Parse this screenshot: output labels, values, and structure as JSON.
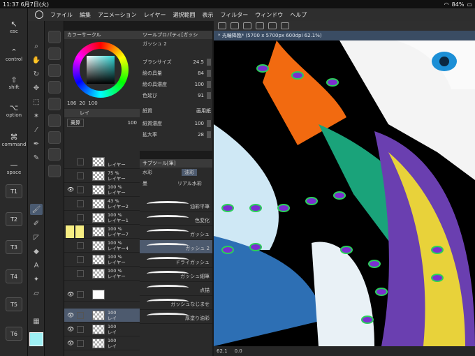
{
  "status": {
    "time": "11:37",
    "date": "6月7日(火)",
    "battery": "84%"
  },
  "menu": [
    "ファイル",
    "編集",
    "アニメーション",
    "レイヤー",
    "選択範囲",
    "表示",
    "フィルター",
    "ウィンドウ",
    "ヘルプ"
  ],
  "shortcuts": [
    {
      "glyph": "↖",
      "label": "esc"
    },
    {
      "glyph": "⌃",
      "label": "control"
    },
    {
      "glyph": "⇧",
      "label": "shift"
    },
    {
      "glyph": "⌥",
      "label": "option"
    },
    {
      "glyph": "⌘",
      "label": "command"
    },
    {
      "glyph": "—",
      "label": "space"
    }
  ],
  "tkeys": [
    "T1",
    "T2",
    "T3",
    "T4",
    "T5",
    "T6"
  ],
  "color_panel": {
    "title": "カラーサークル",
    "values": [
      "186",
      "20",
      "100"
    ]
  },
  "layer_panel": {
    "tab": "レイ",
    "blend": "乗算",
    "opacity": "100",
    "rows": [
      {
        "pct": "",
        "name": "レイヤー"
      },
      {
        "pct": "75 %",
        "name": "レイヤー"
      },
      {
        "pct": "100 %",
        "name": "レイヤー"
      },
      {
        "pct": "43 %",
        "name": "レイヤー2"
      },
      {
        "pct": "100 %",
        "name": "レイヤー1"
      },
      {
        "pct": "100 %",
        "name": "レイヤー7"
      },
      {
        "pct": "100 %",
        "name": "レイヤー4"
      },
      {
        "pct": "100 %",
        "name": "レイヤー"
      },
      {
        "pct": "100 %",
        "name": "レイヤー"
      },
      {
        "pct": "",
        "name": ""
      },
      {
        "pct": "100",
        "name": "レイ"
      },
      {
        "pct": "100",
        "name": "レイ"
      },
      {
        "pct": "100",
        "name": "レイ"
      }
    ]
  },
  "tool_property": {
    "title": "ツールプロパティ[ガッシ",
    "brush": "ガッシュ 2",
    "props": [
      {
        "label": "ブラシサイズ",
        "value": "24.5"
      },
      {
        "label": "絵の具量",
        "value": "84"
      },
      {
        "label": "絵の具濃度",
        "value": "100"
      },
      {
        "label": "色延び",
        "value": "91"
      },
      {
        "label": "紙質",
        "value": "画用紙"
      },
      {
        "label": "紙質濃度",
        "value": "100"
      },
      {
        "label": "拡大率",
        "value": "28"
      }
    ]
  },
  "subtool": {
    "title": "サブツール[筆]",
    "tabs": [
      "水彩",
      "油彩",
      "墨",
      "リアル水彩"
    ],
    "brushes": [
      "油彩平筆",
      "色変化",
      "ガッシュ",
      "ガッシュ 2",
      "ドライガッシュ",
      "ガッシュ細筆",
      "点描",
      "ガッシュなじませ",
      "厚塗り油彩"
    ]
  },
  "document_tab": "* 光輪降臨* (5700 x 5700px 600dpi 62.1%)",
  "status_bar": {
    "zoom": "62.1",
    "angle": "0.0"
  }
}
